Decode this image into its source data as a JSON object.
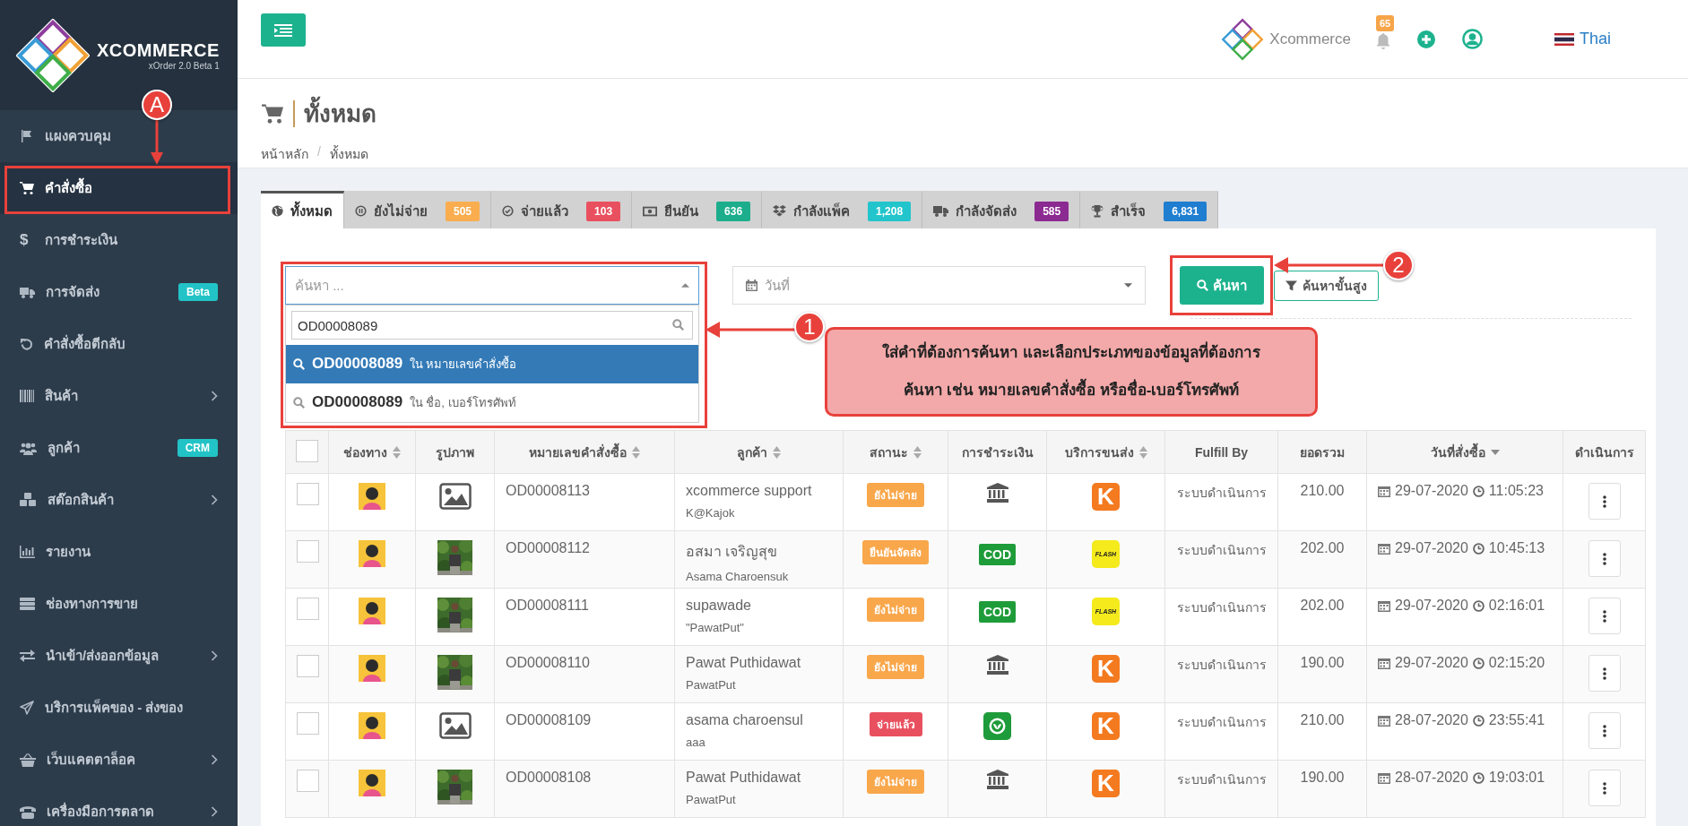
{
  "sidebar": {
    "brand": "XCOMMERCE",
    "version": "xOrder 2.0 Beta 1",
    "items": [
      {
        "label": "แผงควบคุม",
        "selected": false,
        "expandable": false
      },
      {
        "label": "คำสั่งซื้อ",
        "selected": true,
        "expandable": false
      },
      {
        "label": "การชำระเงิน",
        "glyph": "$",
        "selected": false,
        "expandable": false
      },
      {
        "label": "การจัดส่ง",
        "badge": "Beta",
        "selected": false,
        "expandable": false
      },
      {
        "label": "คำสั่งซื้อตีกลับ",
        "selected": false,
        "expandable": false
      },
      {
        "label": "สินค้า",
        "selected": false,
        "expandable": true
      },
      {
        "label": "ลูกค้า",
        "badge": "CRM",
        "selected": false,
        "expandable": false
      },
      {
        "label": "สต๊อกสินค้า",
        "selected": false,
        "expandable": true
      },
      {
        "label": "รายงาน",
        "selected": false,
        "expandable": false
      },
      {
        "label": "ช่องทางการขาย",
        "selected": false,
        "expandable": false
      },
      {
        "label": "นำเข้า/ส่งออกข้อมูล",
        "selected": false,
        "expandable": true
      },
      {
        "label": "บริการแพ็คของ - ส่งของ",
        "selected": false,
        "expandable": false
      },
      {
        "label": "เว็บแคตตาล็อค",
        "selected": false,
        "expandable": true
      },
      {
        "label": "เครื่องมือการตลาด",
        "selected": false,
        "expandable": true
      }
    ]
  },
  "topbar": {
    "brand": "Xcommerce",
    "notifications": "65",
    "language": "Thai"
  },
  "page": {
    "title": "ทั้งหมด",
    "breadcrumb": [
      "หน้าหลัก",
      "ทั้งหมด"
    ],
    "breadcrumb_separator": "/"
  },
  "tabs": [
    {
      "label": "ทั้งหมด",
      "selected": true
    },
    {
      "label": "ยังไม่จ่าย",
      "count": "505",
      "color": "#f9ad4f",
      "selected": false
    },
    {
      "label": "จ่ายแล้ว",
      "count": "103",
      "color": "#e9505f",
      "selected": false
    },
    {
      "label": "ยืนยัน",
      "count": "636",
      "color": "#1cad8c",
      "selected": false
    },
    {
      "label": "กำลังแพ็ค",
      "count": "1,208",
      "color": "#23c5cc",
      "selected": false
    },
    {
      "label": "กำลังจัดส่ง",
      "count": "585",
      "color": "#8b2a91",
      "selected": false
    },
    {
      "label": "สำเร็จ",
      "count": "6,831",
      "color": "#1f7ed0",
      "selected": false
    }
  ],
  "filters": {
    "search": {
      "placeholder": "ค้นหา ...",
      "query": "OD00008089",
      "expanded": true,
      "options": [
        {
          "text": "**OD00008089** ใน หมายเลขคำสั่งซื้อ",
          "selected": true
        },
        {
          "text": "**OD00008089** ใน ชื่อ, เบอร์โทรศัพท์",
          "selected": false
        }
      ]
    },
    "date": {
      "placeholder": "วันที่"
    },
    "search_button": "ค้นหา",
    "advanced_button": "ค้นหาขั้นสูง"
  },
  "table": {
    "columns": [
      {
        "kind": "checkbox",
        "checked": false
      },
      {
        "label": "ช่องทาง",
        "sortable": true,
        "sorted": false
      },
      {
        "label": "รูปภาพ",
        "sortable": false,
        "sorted": false
      },
      {
        "label": "หมายเลขคำสั่งซื้อ",
        "sortable": true,
        "sorted": false
      },
      {
        "label": "ลูกค้า",
        "sortable": true,
        "sorted": false
      },
      {
        "label": "สถานะ",
        "sortable": true,
        "sorted": false
      },
      {
        "label": "การชำระเงิน",
        "sortable": false,
        "sorted": false
      },
      {
        "label": "บริการขนส่ง",
        "sortable": true,
        "sorted": false
      },
      {
        "label": "Fulfill By",
        "sortable": false,
        "sorted": false
      },
      {
        "label": "ยอดรวม",
        "sortable": false,
        "sorted": false
      },
      {
        "label": "วันที่สั่งซื้อ",
        "sortable": true,
        "sorted": true
      },
      {
        "label": "ดำเนินการ",
        "sortable": false,
        "sorted": false
      }
    ],
    "rows": [
      {
        "checked": false,
        "image": {
          "kind": "placeholder"
        },
        "order": "OD00008113",
        "customer": "xcommerce support",
        "note": "K@Kajok",
        "status": {
          "label": "ยังไม่จ่าย",
          "color": "#f9a74b"
        },
        "payment": {
          "kind": "bank"
        },
        "shipping": {
          "kind": "kerry",
          "logo": "K"
        },
        "fulfill": "ระบบดำเนินการ",
        "total": "210.00",
        "date": "29-07-2020",
        "time": "11:05:23"
      },
      {
        "checked": false,
        "order": "OD00008112",
        "customer": "อสมา เจริญสุข",
        "note": "Asama Charoensuk",
        "status": {
          "label": "ยืนยันจัดส่ง",
          "color": "#f9a74b"
        },
        "payment": {
          "kind": "cod",
          "label": "COD"
        },
        "shipping": {
          "kind": "flash",
          "logo": "FLASH"
        },
        "fulfill": "ระบบดำเนินการ",
        "total": "202.00",
        "date": "29-07-2020",
        "time": "10:45:13"
      },
      {
        "checked": false,
        "order": "OD00008111",
        "customer": "supawade",
        "note": "\"PawatPut\"",
        "status": {
          "label": "ยังไม่จ่าย",
          "color": "#f9a74b"
        },
        "payment": {
          "kind": "cod",
          "label": "COD"
        },
        "shipping": {
          "kind": "flash",
          "logo": "FLASH"
        },
        "fulfill": "ระบบดำเนินการ",
        "total": "202.00",
        "date": "29-07-2020",
        "time": "02:16:01"
      },
      {
        "checked": false,
        "order": "OD00008110",
        "customer": "Pawat Puthidawat",
        "note": "PawatPut",
        "status": {
          "label": "ยังไม่จ่าย",
          "color": "#f9a74b"
        },
        "payment": {
          "kind": "bank"
        },
        "shipping": {
          "kind": "kerry",
          "logo": "K"
        },
        "fulfill": "ระบบดำเนินการ",
        "total": "190.00",
        "date": "29-07-2020",
        "time": "02:15:20"
      },
      {
        "checked": false,
        "image": {
          "kind": "placeholder"
        },
        "order": "OD00008109",
        "customer": "asama charoensul",
        "note": "aaa",
        "status": {
          "label": "จ่ายแล้ว",
          "color": "#e9505f"
        },
        "payment": {
          "kind": "kplus"
        },
        "shipping": {
          "kind": "kerry",
          "logo": "K"
        },
        "fulfill": "ระบบดำเนินการ",
        "total": "210.00",
        "date": "28-07-2020",
        "time": "23:55:41"
      },
      {
        "checked": false,
        "order": "OD00008108",
        "customer": "Pawat Puthidawat",
        "note": "PawatPut",
        "status": {
          "label": "ยังไม่จ่าย",
          "color": "#f9a74b"
        },
        "payment": {
          "kind": "bank"
        },
        "shipping": {
          "kind": "kerry",
          "logo": "K"
        },
        "fulfill": "ระบบดำเนินการ",
        "total": "190.00",
        "date": "28-07-2020",
        "time": "19:03:01"
      }
    ]
  },
  "annotations": [
    {
      "kind": "marker",
      "label": "A"
    },
    {
      "kind": "marker",
      "label": "1"
    },
    {
      "kind": "marker",
      "label": "2"
    },
    {
      "kind": "callout",
      "text": "ใส่คำที่ต้องการค้นหา และเลือกประเภทของข้อมูลที่ต้องการ\nค้นหา เช่น หมายเลขคำสั่งซื้อ หรือชื่อ-เบอร์โทรศัพท์"
    }
  ]
}
